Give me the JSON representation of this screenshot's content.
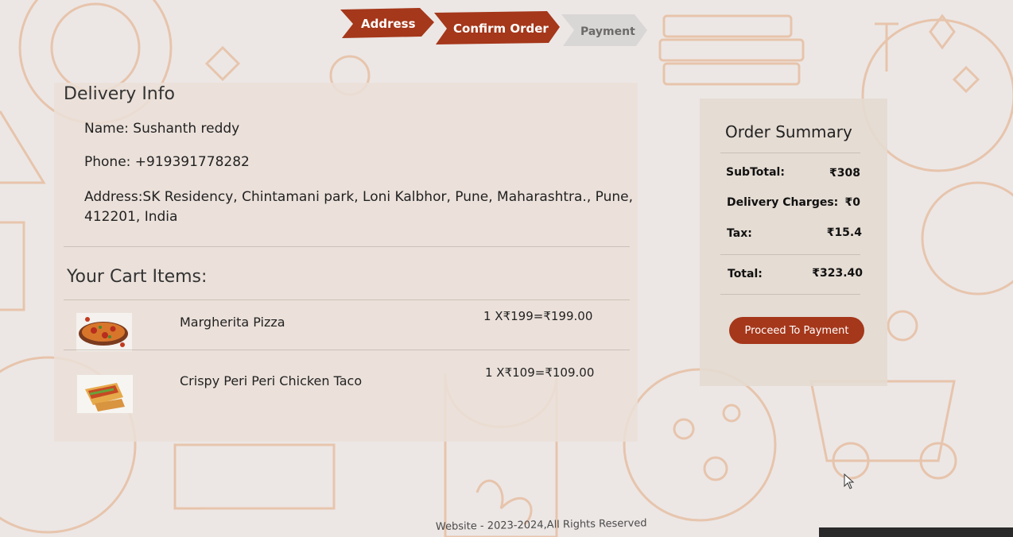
{
  "stepper": {
    "steps": [
      {
        "label": "Address",
        "state": "done"
      },
      {
        "label": "Confirm Order",
        "state": "active"
      },
      {
        "label": "Payment",
        "state": "pending"
      }
    ],
    "active_color": "#a5371a",
    "pending_color": "#d9d6d6"
  },
  "delivery": {
    "title": "Delivery Info",
    "name": "Name: Sushanth reddy",
    "phone": "Phone: +919391778282",
    "address_line1": "Address:SK Residency, Chintamani park, Loni Kalbhor, Pune, Maharashtra., Pune,",
    "address_line2": "412201, India"
  },
  "cart": {
    "title": "Your Cart Items:",
    "items": [
      {
        "name": "Margherita Pizza",
        "price": "1 X₹199=₹199.00",
        "icon": "pizza-image"
      },
      {
        "name": "Crispy Peri Peri Chicken Taco",
        "price": "1 X₹109=₹109.00",
        "icon": "taco-image"
      }
    ]
  },
  "summary": {
    "title": "Order Summary",
    "subtotal_label": "SubTotal:",
    "subtotal_value": "₹308",
    "delivery_label": "Delivery Charges:",
    "delivery_value": "₹0",
    "tax_label": "Tax:",
    "tax_value": "₹15.4",
    "total_label": "Total:",
    "total_value": "₹323.40",
    "button_label": "Proceed To Payment",
    "button_color": "#a5371a"
  },
  "footer": {
    "text": "Website - 2023-2024,All Rights Reserved"
  }
}
